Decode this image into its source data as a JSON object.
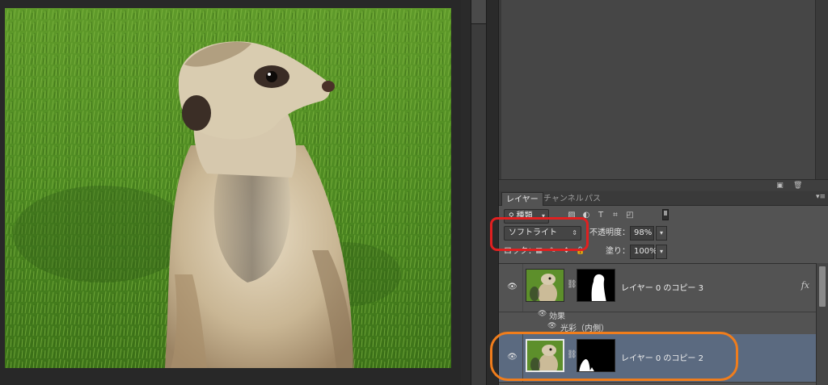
{
  "canvas": {
    "image_description": "meerkat-photo"
  },
  "panel": {
    "tabs": [
      "レイヤー",
      "チャンネル",
      "パス"
    ],
    "kind_filter": "種類",
    "blend_mode": "ソフトライト",
    "opacity_label": "不透明度：",
    "opacity_value": "98%",
    "lock_label": "ロック：",
    "fill_label": "塗り：",
    "fill_value": "100%"
  },
  "layers": [
    {
      "name": "レイヤー 0 のコピー 3",
      "has_fx": true,
      "fx_label": "fx",
      "selected": false
    },
    {
      "name": "レイヤー 0 のコピー 2",
      "has_fx": false,
      "selected": true
    }
  ],
  "effects": {
    "header": "効果",
    "item": "光彩（内側）"
  },
  "colors": {
    "selected_row": "#5b6a80",
    "annotation_red": "#e02020",
    "annotation_orange": "#f07d1c"
  }
}
